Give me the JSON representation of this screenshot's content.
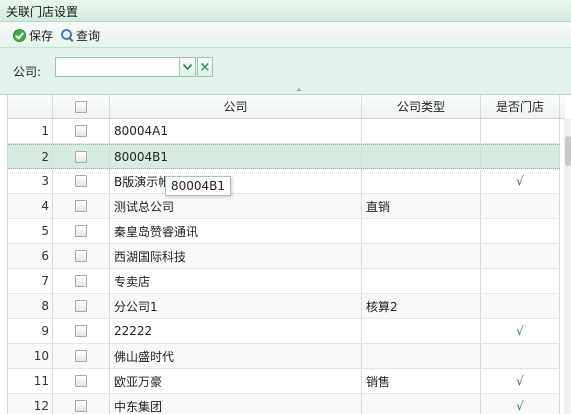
{
  "window": {
    "title": "关联门店设置"
  },
  "toolbar": {
    "save_label": "保存",
    "query_label": "查询"
  },
  "filter": {
    "company_label": "公司:",
    "company_value": ""
  },
  "grid": {
    "headers": {
      "company": "公司",
      "type": "公司类型",
      "is_store": "是否门店"
    },
    "rows": [
      {
        "num": "1",
        "company": "80004A1",
        "type": "",
        "is_store": ""
      },
      {
        "num": "2",
        "company": "80004B1",
        "type": "",
        "is_store": ""
      },
      {
        "num": "3",
        "company": "B版演示帐",
        "type": "",
        "is_store": "√"
      },
      {
        "num": "4",
        "company": "测试总公司",
        "type": "直销",
        "is_store": ""
      },
      {
        "num": "5",
        "company": "秦皇岛赞睿通讯",
        "type": "",
        "is_store": ""
      },
      {
        "num": "6",
        "company": "西湖国际科技",
        "type": "",
        "is_store": ""
      },
      {
        "num": "7",
        "company": "专卖店",
        "type": "",
        "is_store": ""
      },
      {
        "num": "8",
        "company": "分公司1",
        "type": "核算2",
        "is_store": ""
      },
      {
        "num": "9",
        "company": "22222",
        "type": "",
        "is_store": "√"
      },
      {
        "num": "10",
        "company": "佛山盛时代",
        "type": "",
        "is_store": ""
      },
      {
        "num": "11",
        "company": "欧亚万豪",
        "type": "销售",
        "is_store": "√"
      },
      {
        "num": "12",
        "company": "中东集团",
        "type": "",
        "is_store": "√"
      }
    ]
  },
  "tooltip": {
    "text": "80004B1"
  }
}
